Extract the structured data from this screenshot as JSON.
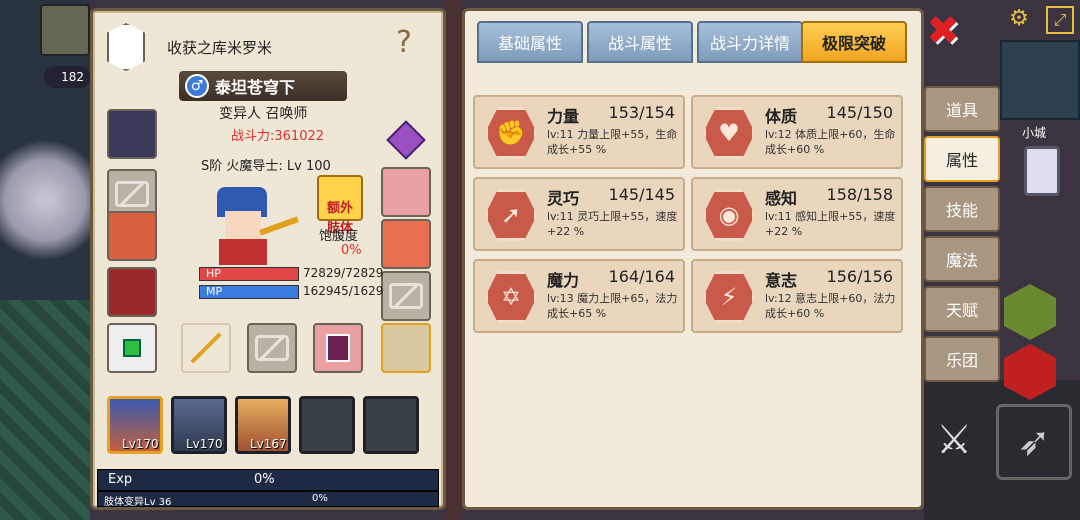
{
  "character": {
    "title": "收获之库米罗米",
    "name": "泰坦苍穹下",
    "race_class": "变异人 召唤师",
    "power_label": "战斗力:361022",
    "rank_level": "S阶 火魔导士: Lv 100",
    "extra_limb_button": "额外\n肢体",
    "satiety_label": "饱腹度",
    "satiety_value": "0%",
    "hp_label": "HP",
    "hp_value": "72829/72829",
    "mp_label": "MP",
    "mp_value": "162945/1629",
    "hp_percent": 100,
    "mp_percent": 100
  },
  "party": [
    {
      "level": "Lv170"
    },
    {
      "level": "Lv170"
    },
    {
      "level": "Lv167"
    },
    {
      "level": ""
    },
    {
      "level": ""
    }
  ],
  "exp": {
    "label": "Exp",
    "value": "0%",
    "limb_label": "肢体变异Lv 36",
    "limb_value": "0%"
  },
  "tabs": [
    {
      "label": "基础属性"
    },
    {
      "label": "战斗属性"
    },
    {
      "label": "战斗力详情"
    },
    {
      "label": "极限突破"
    }
  ],
  "stats": [
    {
      "name": "力量",
      "value": "153/154",
      "desc": "lv:11 力量上限+55，生命成长+55 %",
      "icon": "muscle-icon"
    },
    {
      "name": "体质",
      "value": "145/150",
      "desc": "lv:12 体质上限+60，生命成长+60 %",
      "icon": "body-icon"
    },
    {
      "name": "灵巧",
      "value": "145/145",
      "desc": "lv:11 灵巧上限+55，速度+22 %",
      "icon": "running-icon"
    },
    {
      "name": "感知",
      "value": "158/158",
      "desc": "lv:11 感知上限+55，速度+22 %",
      "icon": "eye-icon"
    },
    {
      "name": "魔力",
      "value": "164/164",
      "desc": "lv:13 魔力上限+65，法力成长+65 %",
      "icon": "hexagram-icon"
    },
    {
      "name": "意志",
      "value": "156/156",
      "desc": "lv:12 意志上限+60，法力成长+60 %",
      "icon": "will-icon"
    }
  ],
  "side_tabs": [
    {
      "label": "道具"
    },
    {
      "label": "属性"
    },
    {
      "label": "技能"
    },
    {
      "label": "魔法"
    },
    {
      "label": "天赋"
    },
    {
      "label": "乐团"
    }
  ],
  "hud": {
    "item_count": "182",
    "city_label": "小城"
  },
  "colors": {
    "accent": "#f0a520",
    "hp": "#e04848",
    "mp": "#3a7be0",
    "power_text": "#d83030",
    "stat_icon": "#c95a4a"
  }
}
